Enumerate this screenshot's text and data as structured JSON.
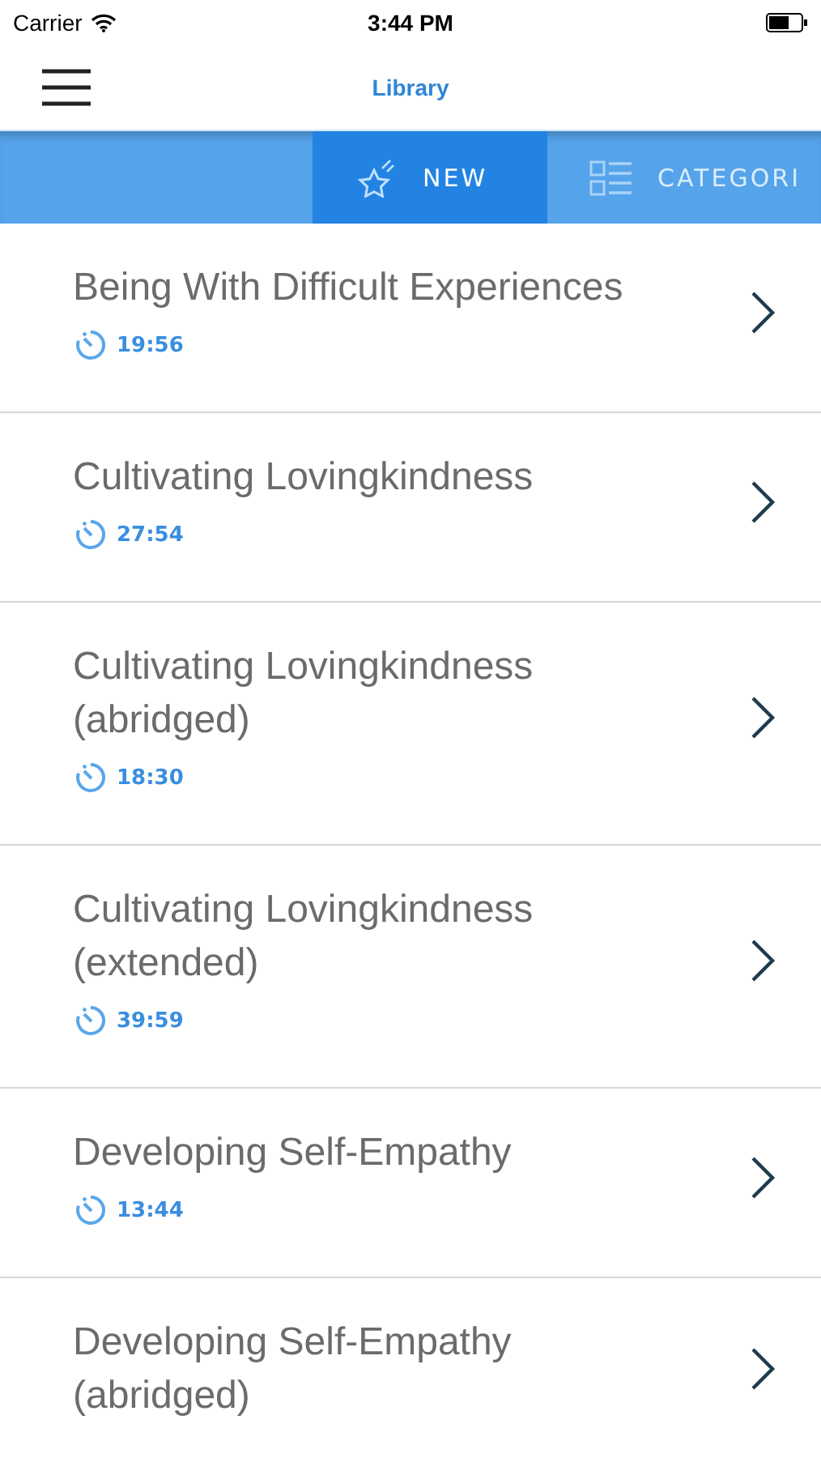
{
  "status_bar": {
    "carrier": "Carrier",
    "time": "3:44 PM"
  },
  "nav": {
    "title": "Library"
  },
  "tabs": [
    {
      "label": "NEW",
      "kind": "new",
      "selected": true
    },
    {
      "label": "CATEGORI",
      "kind": "categories",
      "selected": false
    }
  ],
  "items": [
    {
      "title": "Being With Difficult Experiences",
      "duration": "19:56"
    },
    {
      "title": "Cultivating Lovingkindness",
      "duration": "27:54"
    },
    {
      "title": "Cultivating Lovingkindness (abridged)",
      "duration": "18:30"
    },
    {
      "title": "Cultivating Lovingkindness (extended)",
      "duration": "39:59"
    },
    {
      "title": "Developing Self-Empathy",
      "duration": "13:44"
    },
    {
      "title": "Developing Self-Empathy (abridged)"
    }
  ]
}
